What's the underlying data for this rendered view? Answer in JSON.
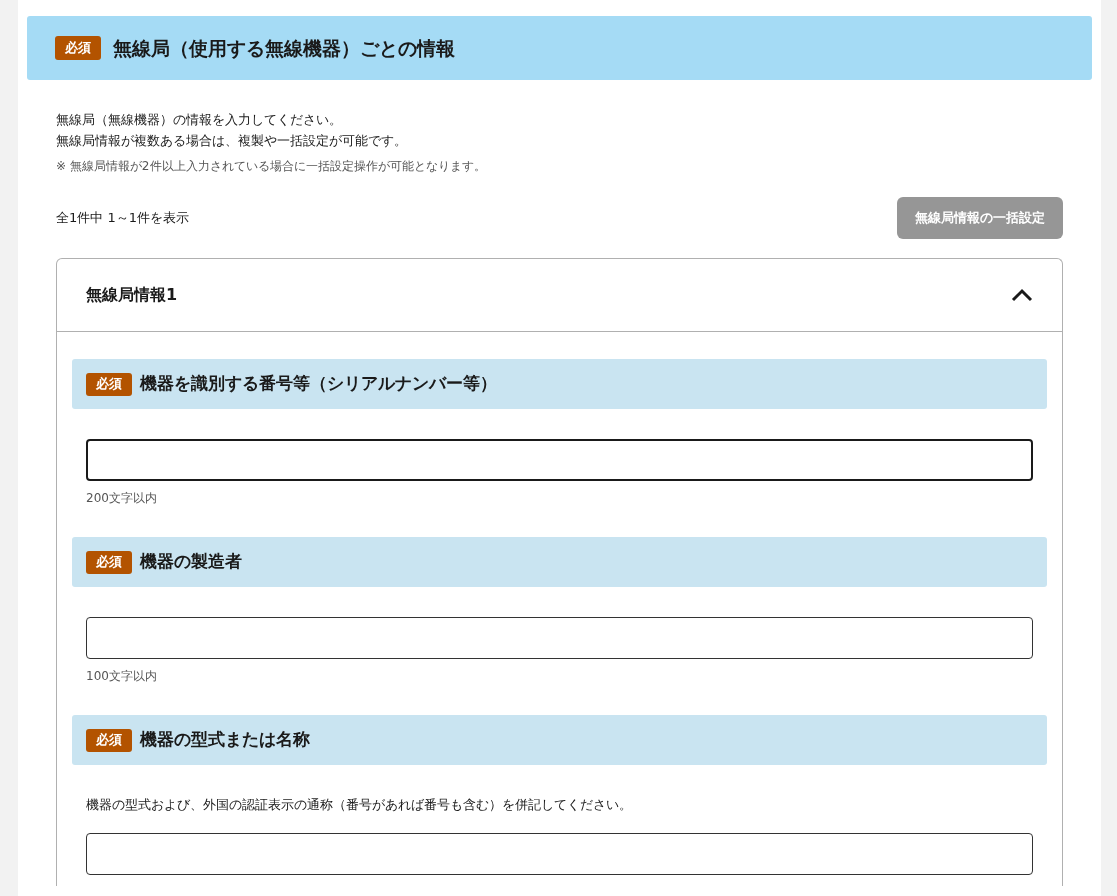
{
  "section": {
    "required_badge": "必須",
    "title": "無線局（使用する無線機器）ごとの情報"
  },
  "intro": [
    "無線局（無線機器）の情報を入力してください。",
    "無線局情報が複数ある場合は、複製や一括設定が可能です。"
  ],
  "note": "※  無線局情報が2件以上入力されている場合に一括設定操作が可能となります。",
  "count": "全1件中 1～1件を表示",
  "bulk_button": {
    "label": "無線局情報の一括設定",
    "disabled": true
  },
  "card": {
    "title": "無線局情報1",
    "expanded": true,
    "fields": [
      {
        "required_badge": "必須",
        "label": "機器を識別する番号等（シリアルナンバー等）",
        "focused": true,
        "hint": "200文字以内"
      },
      {
        "required_badge": "必須",
        "label": "機器の製造者",
        "focused": false,
        "hint": "100文字以内"
      },
      {
        "required_badge": "必須",
        "label": "機器の型式または名称",
        "focused": false,
        "description": "機器の型式および、外国の認証表示の通称（番号があれば番号も含む）を併記してください。"
      }
    ]
  }
}
